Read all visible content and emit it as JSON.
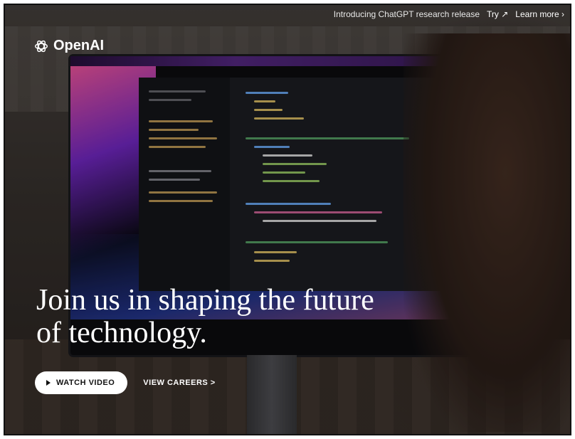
{
  "banner": {
    "intro_text": "Introducing ChatGPT research release",
    "try_link": "Try ↗",
    "learn_more_link": "Learn more ›"
  },
  "logo": {
    "text": "OpenAI",
    "icon": "openai-logo-icon"
  },
  "hero": {
    "headline_line1": "Join us in shaping the future",
    "headline_line2": "of technology.",
    "watch_video_label": "WATCH VIDEO",
    "view_careers_label": "VIEW CAREERS >"
  },
  "colors": {
    "text": "#ffffff",
    "button_bg": "#ffffff",
    "button_text": "#111111"
  }
}
